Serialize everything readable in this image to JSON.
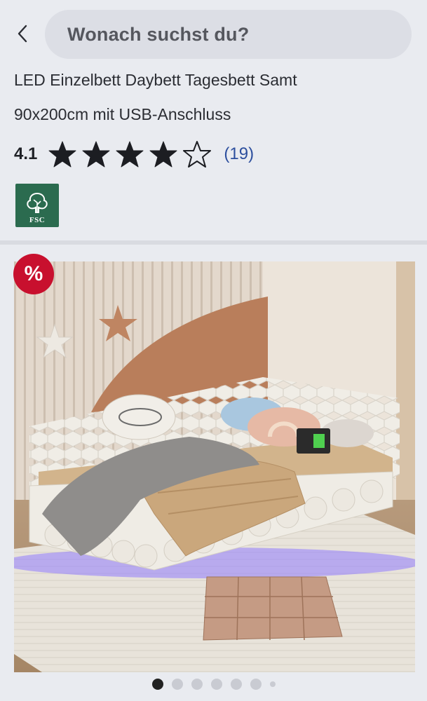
{
  "header": {
    "search_placeholder": "Wonach suchst du?"
  },
  "product": {
    "title_line1": "LED Einzelbett Daybett Tagesbett Samt",
    "title_line2": "90x200cm mit USB-Anschluss",
    "rating": "4.1",
    "rating_value": 4.1,
    "rating_max": 5,
    "stars_filled": 4,
    "review_count": "(19)",
    "certification_label": "FSC",
    "sale_symbol": "%"
  },
  "gallery": {
    "total_dots": 7,
    "active_index": 0
  },
  "colors": {
    "link": "#2d4f9e",
    "sale": "#c8102e",
    "fsc_green": "#2b6b4f"
  }
}
